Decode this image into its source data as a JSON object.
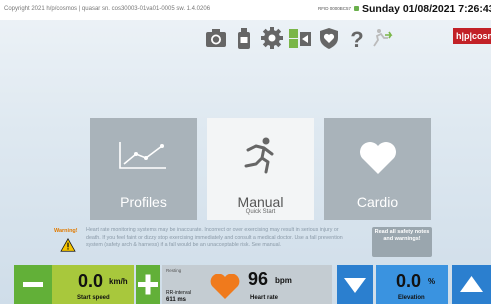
{
  "status_bar": {
    "copyright": "Copyright 2021 h/p/cosmos | quasar  sn. cos30003-01va01-0005  sw. 1.4.0206",
    "rfid": "RFID 0000BC57",
    "datetime": "Sunday 01/08/2021  7:26:43 P"
  },
  "toolbar": {
    "brand": "h|p|cosmos",
    "icons": [
      "camera-icon",
      "bottle-icon",
      "gear-icon",
      "settings-panel-icon",
      "shield-heart-icon",
      "help-icon",
      "running-arrow-icon"
    ]
  },
  "tiles": {
    "profiles": {
      "label": "Profiles"
    },
    "manual": {
      "label": "Manual",
      "sub": "Quick Start"
    },
    "cardio": {
      "label": "Cardio"
    }
  },
  "warning": {
    "title": "Warning!",
    "text": "Heart rate monitoring systems may be inaccurate. Incorrect or over exercising may result in serious injury or death. If you feel faint or dizzy stop exercising immediately and consult a medical doctor. Use a fall prevention system (safety arch & harness) if a fall would be an unacceptable risk. See manual.",
    "read_all": "Read all safety notes and warnings!"
  },
  "speed": {
    "value": "0.0",
    "unit": "km/h",
    "caption": "Start speed"
  },
  "heart": {
    "mode": "Resting",
    "rr_label": "RR-interval",
    "rr_value": "611 ms",
    "value": "96",
    "unit": "bpm",
    "caption": "Heart rate"
  },
  "elevation": {
    "value": "0.0",
    "unit": "%",
    "caption": "Elevation"
  },
  "colors": {
    "green_button": "#62b038",
    "speed_box": "#a8c83c",
    "blue_button": "#2b7fcf",
    "elevation_box": "#3a93e0",
    "heart": "#f07a1c",
    "brand": "#c22127"
  }
}
